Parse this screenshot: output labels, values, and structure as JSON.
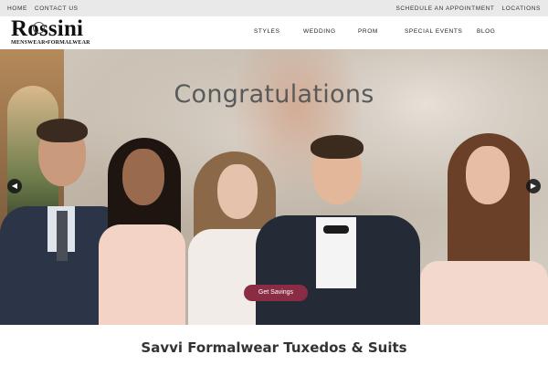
{
  "topbar": {
    "left_links": [
      "HOME",
      "CONTACT US"
    ],
    "right_links": [
      "SCHEDULE AN APPOINTMENT",
      "LOCATIONS"
    ]
  },
  "brand": {
    "name": "Rossini",
    "tagline": "MENSWEAR•FORMALWEAR"
  },
  "nav": {
    "items": [
      "STYLES",
      "WEDDING",
      "PROM",
      "SPECIAL EVENTS",
      "BLOG"
    ]
  },
  "hero": {
    "title": "Congratulations",
    "cta_label": "Get Savings",
    "prev_icon": "chevron-left-icon",
    "next_icon": "chevron-right-icon",
    "prev_glyph": "◀",
    "next_glyph": "▶"
  },
  "section": {
    "title": "Savvi Formalwear Tuxedos & Suits"
  },
  "colors": {
    "topbar_bg": "#e9e9e9",
    "cta_bg": "#8a2c44",
    "title_text": "#5a5a5a"
  }
}
